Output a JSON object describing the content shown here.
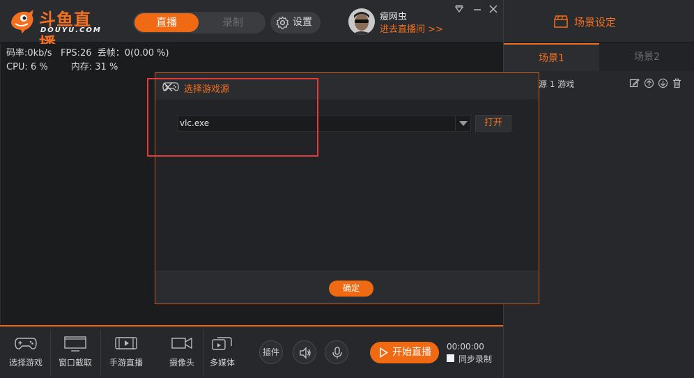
{
  "app": {
    "logo_cn": "斗鱼直播",
    "logo_en": "DOUYU.COM",
    "brand_color": "#f06a13"
  },
  "header": {
    "mode_live": "直播",
    "mode_record": "录制",
    "settings_label": "设置",
    "username": "瘦网虫",
    "goto_room": "进去直播间 >>"
  },
  "stats": {
    "bitrate": "码率:0kb/s",
    "fps": "FPS:26",
    "dropped": "丢帧：0(0.00 %)",
    "cpu": "CPU: 6 %",
    "memory": "内存: 31 %"
  },
  "scene_panel": {
    "title": "场景设定",
    "tabs": [
      "场景1",
      "场景2"
    ],
    "active_tab": 0,
    "source_item": "源 1 游戏"
  },
  "dialog": {
    "title": "选择游戏源",
    "selected_value": "vlc.exe",
    "open_button": "打开",
    "confirm_button": "确定"
  },
  "toolbar": {
    "tools": [
      "选择游戏",
      "窗口截取",
      "手游直播",
      "摄像头",
      "多媒体"
    ],
    "plugin": "插件",
    "start_live": "开始直播",
    "timer": "00:00:00",
    "sync_record": "同步录制"
  }
}
